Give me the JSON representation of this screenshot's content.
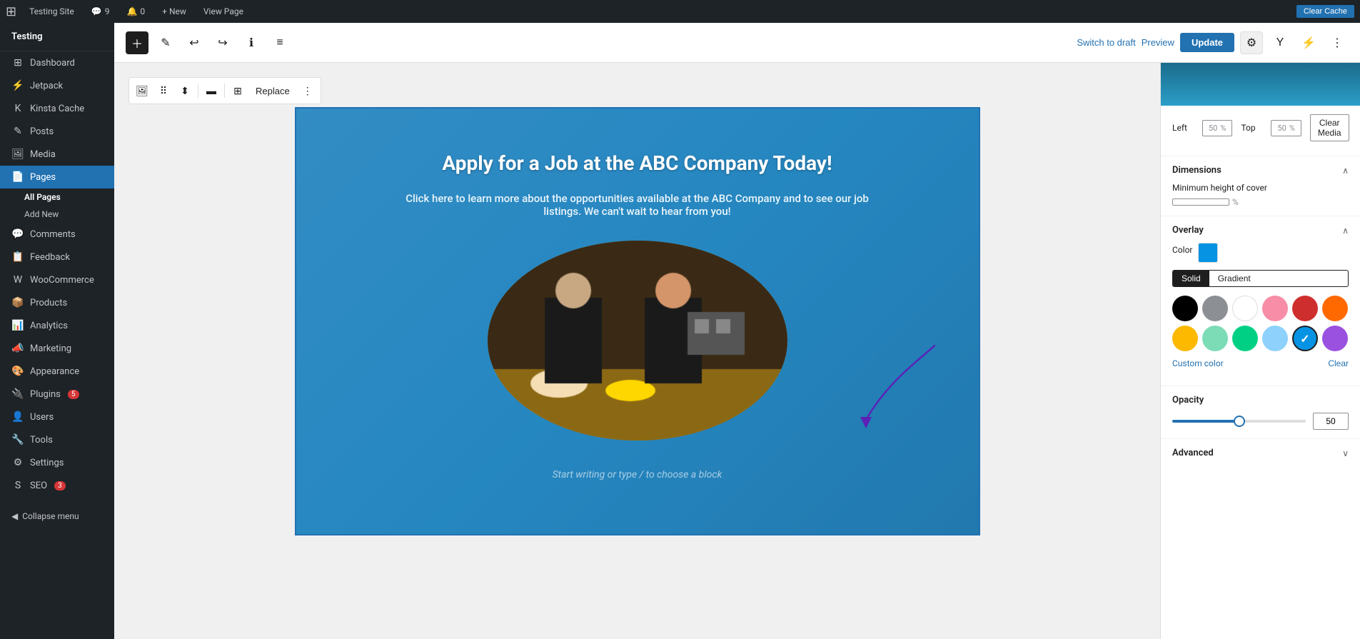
{
  "adminBar": {
    "site_name": "Testing Site",
    "comment_count": "9",
    "notification_count": "0",
    "new_label": "+ New",
    "view_page_label": "View Page",
    "clear_cache_label": "Clear Cache"
  },
  "sidebar": {
    "brand": "Testing",
    "items": [
      {
        "id": "dashboard",
        "label": "Dashboard",
        "icon": "⊞"
      },
      {
        "id": "jetpack",
        "label": "Jetpack",
        "icon": "J"
      },
      {
        "id": "kinsta-cache",
        "label": "Kinsta Cache",
        "icon": "K"
      },
      {
        "id": "posts",
        "label": "Posts",
        "icon": "✎"
      },
      {
        "id": "media",
        "label": "Media",
        "icon": "🖼"
      },
      {
        "id": "pages",
        "label": "Pages",
        "icon": "📄",
        "active": true
      },
      {
        "id": "comments",
        "label": "Comments",
        "icon": "💬"
      },
      {
        "id": "feedback",
        "label": "Feedback",
        "icon": "📋"
      },
      {
        "id": "woocommerce",
        "label": "WooCommerce",
        "icon": "W"
      },
      {
        "id": "products",
        "label": "Products",
        "icon": "📦"
      },
      {
        "id": "analytics",
        "label": "Analytics",
        "icon": "📊"
      },
      {
        "id": "marketing",
        "label": "Marketing",
        "icon": "📣"
      },
      {
        "id": "appearance",
        "label": "Appearance",
        "icon": "🎨"
      },
      {
        "id": "plugins",
        "label": "Plugins",
        "icon": "🔌",
        "badge": "5"
      },
      {
        "id": "users",
        "label": "Users",
        "icon": "👤"
      },
      {
        "id": "tools",
        "label": "Tools",
        "icon": "🔧"
      },
      {
        "id": "settings",
        "label": "Settings",
        "icon": "⚙"
      },
      {
        "id": "seo",
        "label": "SEO",
        "icon": "S",
        "badge": "3"
      }
    ],
    "pages_submenu": [
      {
        "id": "all-pages",
        "label": "All Pages",
        "active": true
      },
      {
        "id": "add-new",
        "label": "Add New"
      }
    ],
    "collapse_label": "Collapse menu"
  },
  "editorToolbar": {
    "switch_draft_label": "Switch to draft",
    "preview_label": "Preview",
    "update_label": "Update"
  },
  "blockToolbar": {
    "replace_label": "Replace"
  },
  "cover": {
    "title": "Apply for a Job at the ABC Company Today!",
    "subtitle": "Click here to learn more about the opportunities available at the ABC Company and to see our job listings. We can't wait to hear from you!",
    "placeholder_text": "Start writing or type / to choose a block"
  },
  "rightPanel": {
    "position": {
      "left_label": "Left",
      "left_value": "50",
      "top_label": "Top",
      "top_value": "50",
      "unit": "%",
      "clear_media_label": "Clear Media"
    },
    "dimensions": {
      "section_label": "Dimensions",
      "min_height_label": "Minimum height of cover",
      "min_height_value": "",
      "unit": "%"
    },
    "overlay": {
      "section_label": "Overlay",
      "color_label": "Color",
      "solid_label": "Solid",
      "gradient_label": "Gradient",
      "colors": [
        {
          "id": "black",
          "hex": "#000000",
          "selected": false
        },
        {
          "id": "gray",
          "hex": "#8c8f94",
          "selected": false
        },
        {
          "id": "white",
          "hex": "#ffffff",
          "selected": false
        },
        {
          "id": "pink",
          "hex": "#f78da7",
          "selected": false
        },
        {
          "id": "red",
          "hex": "#cf2e2e",
          "selected": false
        },
        {
          "id": "orange",
          "hex": "#ff6900",
          "selected": false
        },
        {
          "id": "yellow",
          "hex": "#fcb900",
          "selected": false
        },
        {
          "id": "light-green",
          "hex": "#7bdcb5",
          "selected": false
        },
        {
          "id": "green",
          "hex": "#00d084",
          "selected": false
        },
        {
          "id": "light-blue",
          "hex": "#8ed1fc",
          "selected": false
        },
        {
          "id": "blue",
          "hex": "#0693e3",
          "selected": true
        },
        {
          "id": "purple",
          "hex": "#9b51e0",
          "selected": false
        }
      ],
      "custom_color_label": "Custom color",
      "clear_label": "Clear"
    },
    "opacity": {
      "section_label": "Opacity",
      "value": "50"
    },
    "advanced": {
      "section_label": "Advanced"
    }
  }
}
